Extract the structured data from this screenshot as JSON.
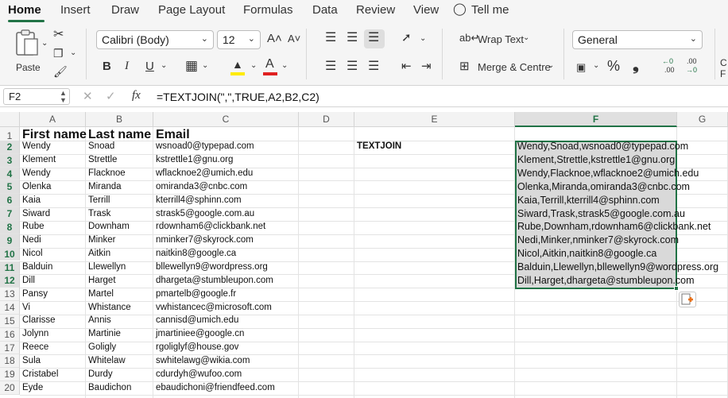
{
  "ribbon_tabs": [
    "Home",
    "Insert",
    "Draw",
    "Page Layout",
    "Formulas",
    "Data",
    "Review",
    "View",
    "Tell me"
  ],
  "ribbon": {
    "paste_label": "Paste",
    "font_name": "Calibri (Body)",
    "font_size": "12",
    "bold": "B",
    "italic": "I",
    "underline": "U",
    "font_color_letter": "A",
    "wrap_text": "Wrap Text",
    "merge_centre": "Merge & Centre",
    "number_format": "General",
    "percent": "%",
    "comma": "❟",
    "inc_decimal_a": "←0",
    "inc_decimal_b": ".00",
    "dec_decimal_a": ".00",
    "dec_decimal_b": "→0",
    "grow_font": "A˄",
    "shrink_font": "A˅",
    "cut_edge_a": "C",
    "cut_edge_b": "F",
    "accent_color": "#217346"
  },
  "formula_bar": {
    "name_box": "F2",
    "fx": "fx",
    "formula": "=TEXTJOIN(\",\",TRUE,A2,B2,C2)"
  },
  "columns": [
    "A",
    "B",
    "C",
    "D",
    "E",
    "F",
    "G"
  ],
  "selected_column": "F",
  "headers": {
    "a": "First name",
    "b": "Last name",
    "c": "Email"
  },
  "e2_label": "TEXTJOIN",
  "rows": [
    {
      "n": "1"
    },
    {
      "n": "2",
      "a": "Wendy",
      "b": "Snoad",
      "c": "wsnoad0@typepad.com",
      "f": "Wendy,Snoad,wsnoad0@typepad.com"
    },
    {
      "n": "3",
      "a": "Klement",
      "b": "Strettle",
      "c": "kstrettle1@gnu.org",
      "f": "Klement,Strettle,kstrettle1@gnu.org"
    },
    {
      "n": "4",
      "a": "Wendy",
      "b": "Flacknoe",
      "c": "wflacknoe2@umich.edu",
      "f": "Wendy,Flacknoe,wflacknoe2@umich.edu"
    },
    {
      "n": "5",
      "a": "Olenka",
      "b": "Miranda",
      "c": "omiranda3@cnbc.com",
      "f": "Olenka,Miranda,omiranda3@cnbc.com"
    },
    {
      "n": "6",
      "a": "Kaia",
      "b": "Terrill",
      "c": "kterrill4@sphinn.com",
      "f": "Kaia,Terrill,kterrill4@sphinn.com"
    },
    {
      "n": "7",
      "a": "Siward",
      "b": "Trask",
      "c": "strask5@google.com.au",
      "f": "Siward,Trask,strask5@google.com.au"
    },
    {
      "n": "8",
      "a": "Rube",
      "b": "Downham",
      "c": "rdownham6@clickbank.net",
      "f": "Rube,Downham,rdownham6@clickbank.net"
    },
    {
      "n": "9",
      "a": "Nedi",
      "b": "Minker",
      "c": "nminker7@skyrock.com",
      "f": "Nedi,Minker,nminker7@skyrock.com"
    },
    {
      "n": "10",
      "a": "Nicol",
      "b": "Aitkin",
      "c": "naitkin8@google.ca",
      "f": "Nicol,Aitkin,naitkin8@google.ca"
    },
    {
      "n": "11",
      "a": "Balduin",
      "b": "Llewellyn",
      "c": "bllewellyn9@wordpress.org",
      "f": "Balduin,Llewellyn,bllewellyn9@wordpress.org"
    },
    {
      "n": "12",
      "a": "Dill",
      "b": "Harget",
      "c": "dhargeta@stumbleupon.com",
      "f": "Dill,Harget,dhargeta@stumbleupon.com"
    },
    {
      "n": "13",
      "a": "Pansy",
      "b": "Martel",
      "c": "pmartelb@google.fr"
    },
    {
      "n": "14",
      "a": "Vi",
      "b": "Whistance",
      "c": "vwhistancec@microsoft.com"
    },
    {
      "n": "15",
      "a": "Clarisse",
      "b": "Annis",
      "c": "cannisd@umich.edu"
    },
    {
      "n": "16",
      "a": "Jolynn",
      "b": "Martinie",
      "c": "jmartiniee@google.cn"
    },
    {
      "n": "17",
      "a": "Reece",
      "b": "Goligly",
      "c": "rgoliglyf@house.gov"
    },
    {
      "n": "18",
      "a": "Sula",
      "b": "Whitelaw",
      "c": "swhitelawg@wikia.com"
    },
    {
      "n": "19",
      "a": "Cristabel",
      "b": "Durdy",
      "c": "cdurdyh@wufoo.com"
    },
    {
      "n": "20",
      "a": "Eyde",
      "b": "Baudichon",
      "c": "ebaudichoni@friendfeed.com"
    }
  ]
}
